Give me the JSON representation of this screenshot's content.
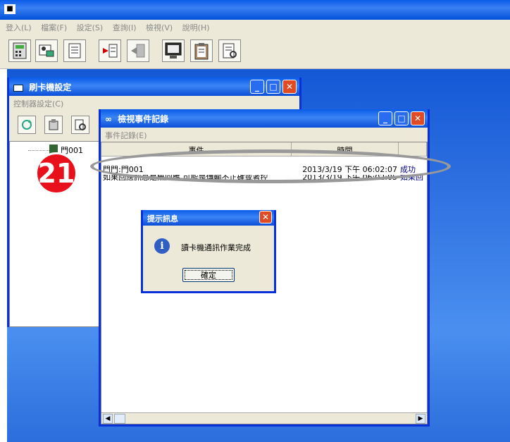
{
  "app": {
    "title": ""
  },
  "menu": {
    "items": [
      "登入(L)",
      "檔案(F)",
      "設定(S)",
      "查詢(I)",
      "檢視(V)",
      "說明(H)"
    ]
  },
  "toolbar": {
    "icons": [
      "calculator-icon",
      "card-user-icon",
      "document-icon",
      "import-icon",
      "export-icon",
      "monitor-icon",
      "clipboard-icon",
      "report-icon"
    ]
  },
  "card_window": {
    "title": "刷卡機設定",
    "menu": "控制器設定(C)",
    "tree_item": "門001"
  },
  "event_window": {
    "title": "檢視事件記錄",
    "menu": "事件記錄(E)",
    "columns": [
      "事件",
      "時間",
      ""
    ],
    "rows": [
      {
        "event": "門門:門001",
        "time": "2013/3/19 下午 06:02:07",
        "status": "成功"
      },
      {
        "event": "如果回應訊息是無回應,可能是傳輸不正確或者控",
        "time": "2013/3/19 下午 06:02:05",
        "status": "如果回"
      }
    ]
  },
  "dialog": {
    "title": "提示訊息",
    "message": "讀卡機通訊作業完成",
    "ok_label": "確定"
  },
  "annotation": {
    "step": "21"
  },
  "colors": {
    "titlebar": "#0a5ce8",
    "close": "#e04b24",
    "badge": "#e8101b",
    "success": "#00008b"
  }
}
